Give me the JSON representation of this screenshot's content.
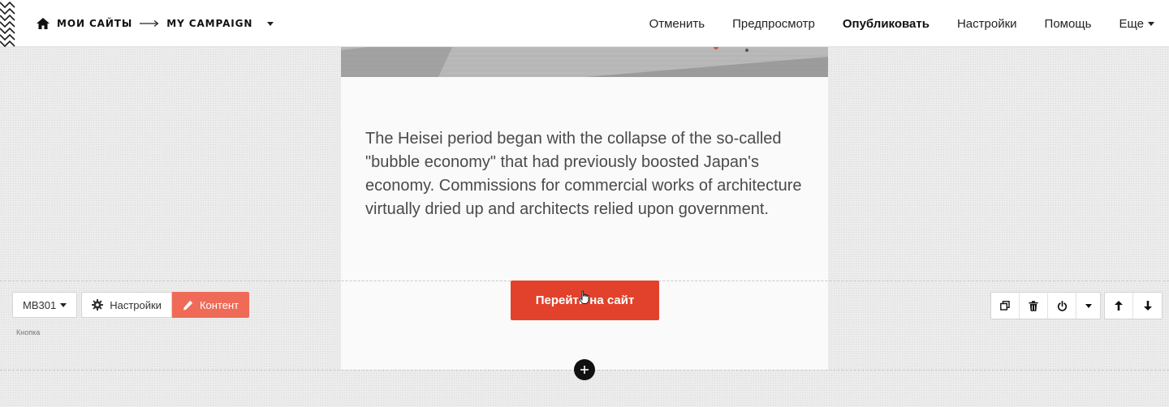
{
  "header": {
    "breadcrumb": [
      "МОИ САЙТЫ",
      "MY CAMPAIGN"
    ],
    "nav": [
      {
        "label": "Отменить"
      },
      {
        "label": "Предпросмотр"
      },
      {
        "label": "Опубликовать"
      },
      {
        "label": "Настройки"
      },
      {
        "label": "Помощь"
      },
      {
        "label": "Еще"
      }
    ]
  },
  "content": {
    "paragraph": "The Heisei period began with the collapse of the so-called \"bubble economy\" that had previously boosted Japan's economy. Commissions for commercial works of architecture virtually dried up and architects relied upon government.",
    "button_label": "Перейти на сайт"
  },
  "block_toolbar": {
    "block_code": "MB301",
    "settings_label": "Настройки",
    "content_label": "Контент",
    "block_type_label": "Кнопка"
  },
  "right_toolbar": {
    "icons": [
      "duplicate-icon",
      "trash-icon",
      "power-icon",
      "chevron-down-icon",
      "arrow-up-icon",
      "arrow-down-icon"
    ]
  },
  "colors": {
    "accent": "#e2422b",
    "content_tab": "#ef6b57",
    "text": "#4a4a4a"
  }
}
